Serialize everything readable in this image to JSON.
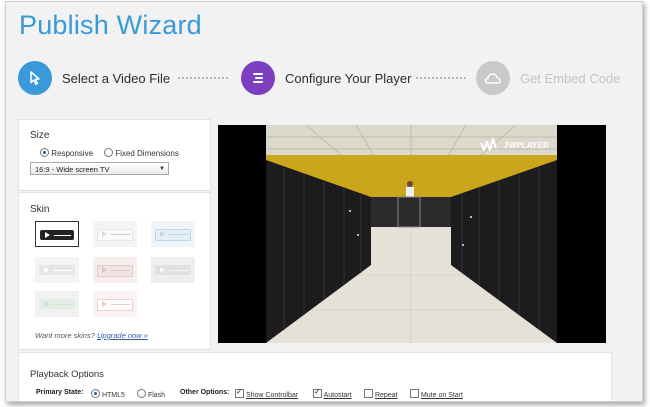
{
  "title": "Publish Wizard",
  "steps": [
    {
      "label": "Select a Video File",
      "icon": "cursor-icon",
      "color": "#3a9ad9",
      "state": "done"
    },
    {
      "label": "Configure Your Player",
      "icon": "list-icon",
      "color": "#7b3fc0",
      "state": "active"
    },
    {
      "label": "Get Embed Code",
      "icon": "cloud-icon",
      "color": "#c9c9c9",
      "state": "pending"
    }
  ],
  "size": {
    "title": "Size",
    "option_responsive": "Responsive",
    "option_fixed": "Fixed Dimensions",
    "selected_option": "Responsive",
    "aspect_value": "16:9 - Wide screen TV"
  },
  "skin": {
    "title": "Skin",
    "more_text": "Want more skins?",
    "more_link": "Upgrade now »"
  },
  "player": {
    "watermark": "JWPLAYER"
  },
  "playback": {
    "title": "Playback Options",
    "primary_state_label": "Primary State:",
    "html5_label": "HTML5",
    "flash_label": "Flash",
    "other_options_label": "Other Options:",
    "show_controlbar_label": "Show Controlbar",
    "autostart_label": "Autostart",
    "repeat_label": "Repeat",
    "mute_label": "Mute on Start",
    "show_controlbar": true,
    "autostart": true,
    "repeat": false,
    "mute_on_start": false
  },
  "colors": {
    "accent_blue": "#3a9ad9",
    "accent_purple": "#7b3fc0",
    "disabled_gray": "#c9c9c9"
  }
}
